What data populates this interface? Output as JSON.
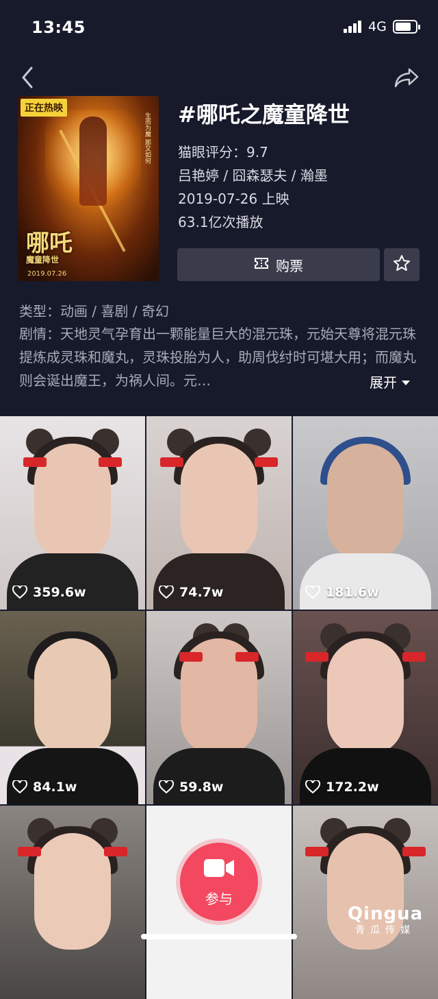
{
  "status_bar": {
    "time": "13:45",
    "network": "4G"
  },
  "movie": {
    "poster_badge": "正在热映",
    "poster_title": "哪吒",
    "poster_subtitle": "魔童降世",
    "poster_date": "2019.07.26",
    "poster_tagline": "生而为魔 那又如何",
    "title": "#哪吒之魔童降世",
    "rating": "猫眼评分：9.7",
    "cast": "吕艳婷 / 囧森瑟夫 / 瀚墨",
    "release": "2019-07-26 上映",
    "plays": "63.1亿次播放",
    "buy_label": "购票",
    "genre": "类型：动画 / 喜剧 / 奇幻",
    "plot": "剧情：天地灵气孕育出一颗能量巨大的混元珠，元始天尊将混元珠提炼成灵珠和魔丸，灵珠投胎为人，助周伐纣时可堪大用；而魔丸则会诞出魔王，为祸人间。元…",
    "expand_label": "展开"
  },
  "videos": [
    {
      "likes": "359.6w"
    },
    {
      "likes": "74.7w"
    },
    {
      "likes": "181.6w"
    },
    {
      "likes": "84.1w"
    },
    {
      "likes": "59.8w"
    },
    {
      "likes": "172.2w"
    }
  ],
  "join": {
    "label": "参与"
  },
  "watermark": {
    "main": "Qingua",
    "sub": "青瓜传媒"
  },
  "colors": {
    "background": "#171a2b",
    "button": "#3a3c4c",
    "accent": "#f34860"
  }
}
